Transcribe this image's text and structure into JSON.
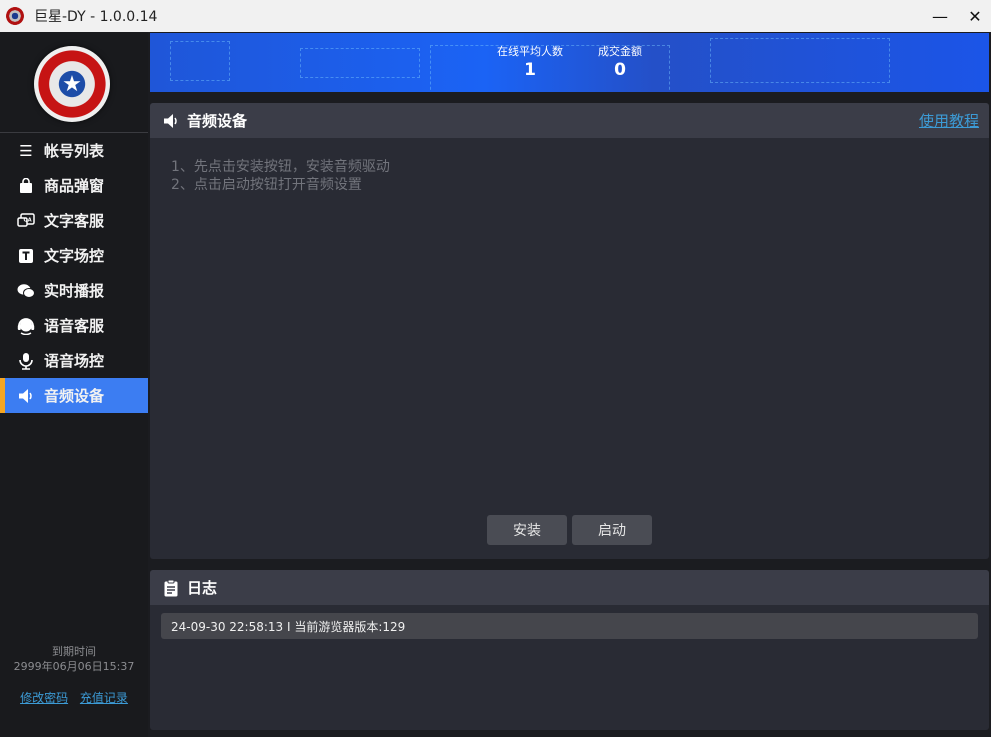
{
  "window": {
    "title": "巨星-DY - 1.0.0.14",
    "minimize": "—",
    "close": "✕"
  },
  "sidebar": {
    "items": [
      {
        "label": "帐号列表",
        "icon": "list-icon"
      },
      {
        "label": "商品弹窗",
        "icon": "shopping-bag-icon"
      },
      {
        "label": "文字客服",
        "icon": "qa-chat-icon"
      },
      {
        "label": "文字场控",
        "icon": "text-t-icon"
      },
      {
        "label": "实时播报",
        "icon": "wechat-bubbles-icon"
      },
      {
        "label": "语音客服",
        "icon": "headset-icon"
      },
      {
        "label": "语音场控",
        "icon": "microphone-icon"
      },
      {
        "label": "音频设备",
        "icon": "speaker-icon",
        "active": true
      }
    ],
    "expire_label": "到期时间",
    "expire_value": "2999年06月06日15:37",
    "change_password": "修改密码",
    "recharge_log": "充值记录"
  },
  "banner": {
    "stats": [
      {
        "label": "在线平均人数",
        "value": "1"
      },
      {
        "label": "成交金额",
        "value": "0"
      }
    ]
  },
  "audio_panel": {
    "title": "音频设备",
    "help_link": "使用教程",
    "instructions": [
      "1、先点击安装按钮，安装音频驱动",
      "2、点击启动按钮打开音频设置"
    ],
    "install_button": "安装",
    "start_button": "启动"
  },
  "log_panel": {
    "title": "日志",
    "entries": [
      "24-09-30 22:58:13 I  当前游览器版本:129"
    ]
  },
  "colors": {
    "accent": "#3c7df2",
    "active_marker": "#f5a623",
    "link": "#3c9bd6",
    "panel_bg": "#292b34"
  }
}
